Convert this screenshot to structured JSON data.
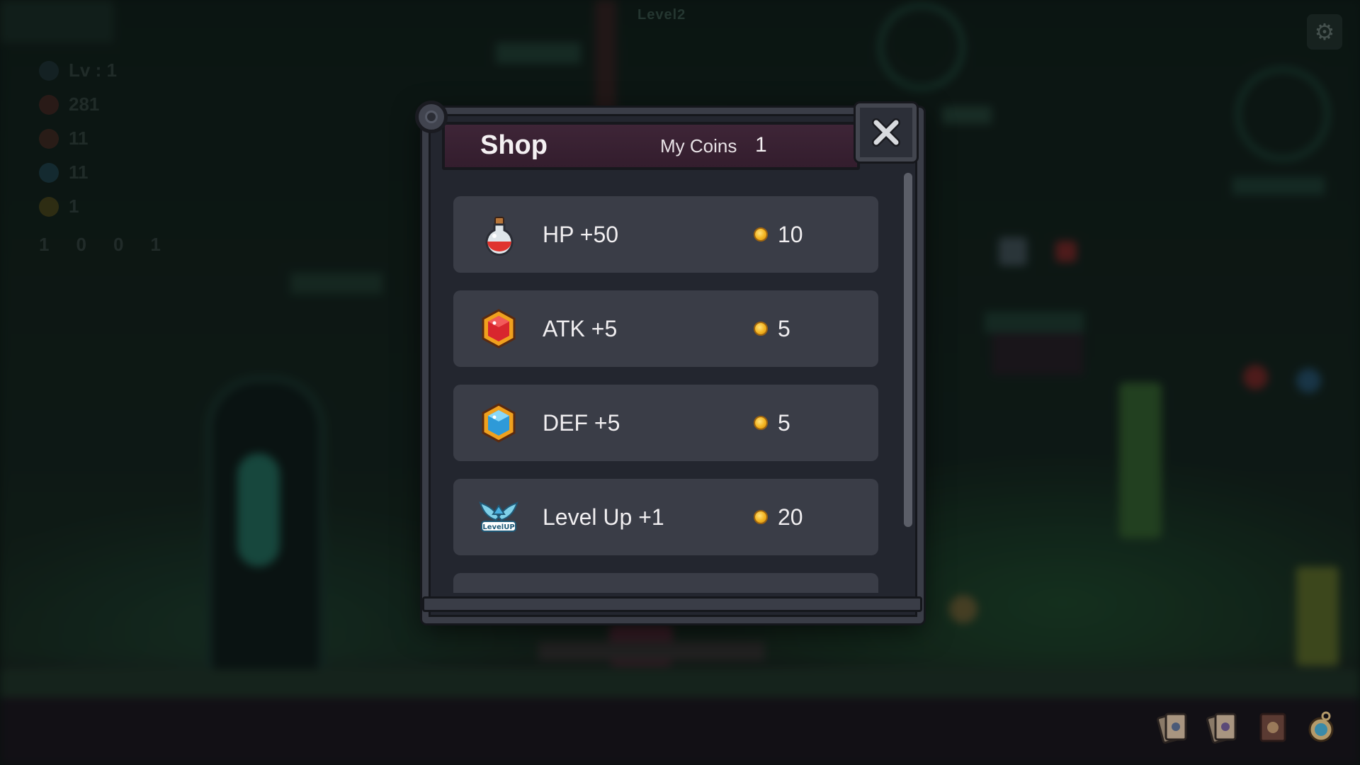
{
  "background": {
    "level_label": "Level2",
    "hud": [
      {
        "name": "level",
        "text": "Lv : 1",
        "color": "#6fa3c8"
      },
      {
        "name": "hp",
        "text": "281",
        "color": "#d23a3a"
      },
      {
        "name": "atk",
        "text": "11",
        "color": "#d24a3a"
      },
      {
        "name": "def",
        "text": "11",
        "color": "#4aa3d8"
      },
      {
        "name": "coins",
        "text": "1",
        "color": "#f2b31e"
      }
    ],
    "keys": [
      "1",
      "0",
      "0",
      "1"
    ]
  },
  "shop": {
    "title": "Shop",
    "coins_label": "My Coins",
    "coins_value": "1",
    "items": [
      {
        "label": "HP +50",
        "price": "10",
        "icon": "potion-icon"
      },
      {
        "label": "ATK +5",
        "price": "5",
        "icon": "red-gem-icon"
      },
      {
        "label": "DEF +5",
        "price": "5",
        "icon": "blue-gem-icon"
      },
      {
        "label": "Level Up +1",
        "price": "20",
        "icon": "level-up-icon"
      }
    ],
    "level_up_badge": "LevelUP"
  },
  "colors": {
    "window_bg": "#23262f",
    "item_bg": "#3a3d47",
    "header_bg": "#3e2537",
    "coin": "#f2b31e"
  }
}
